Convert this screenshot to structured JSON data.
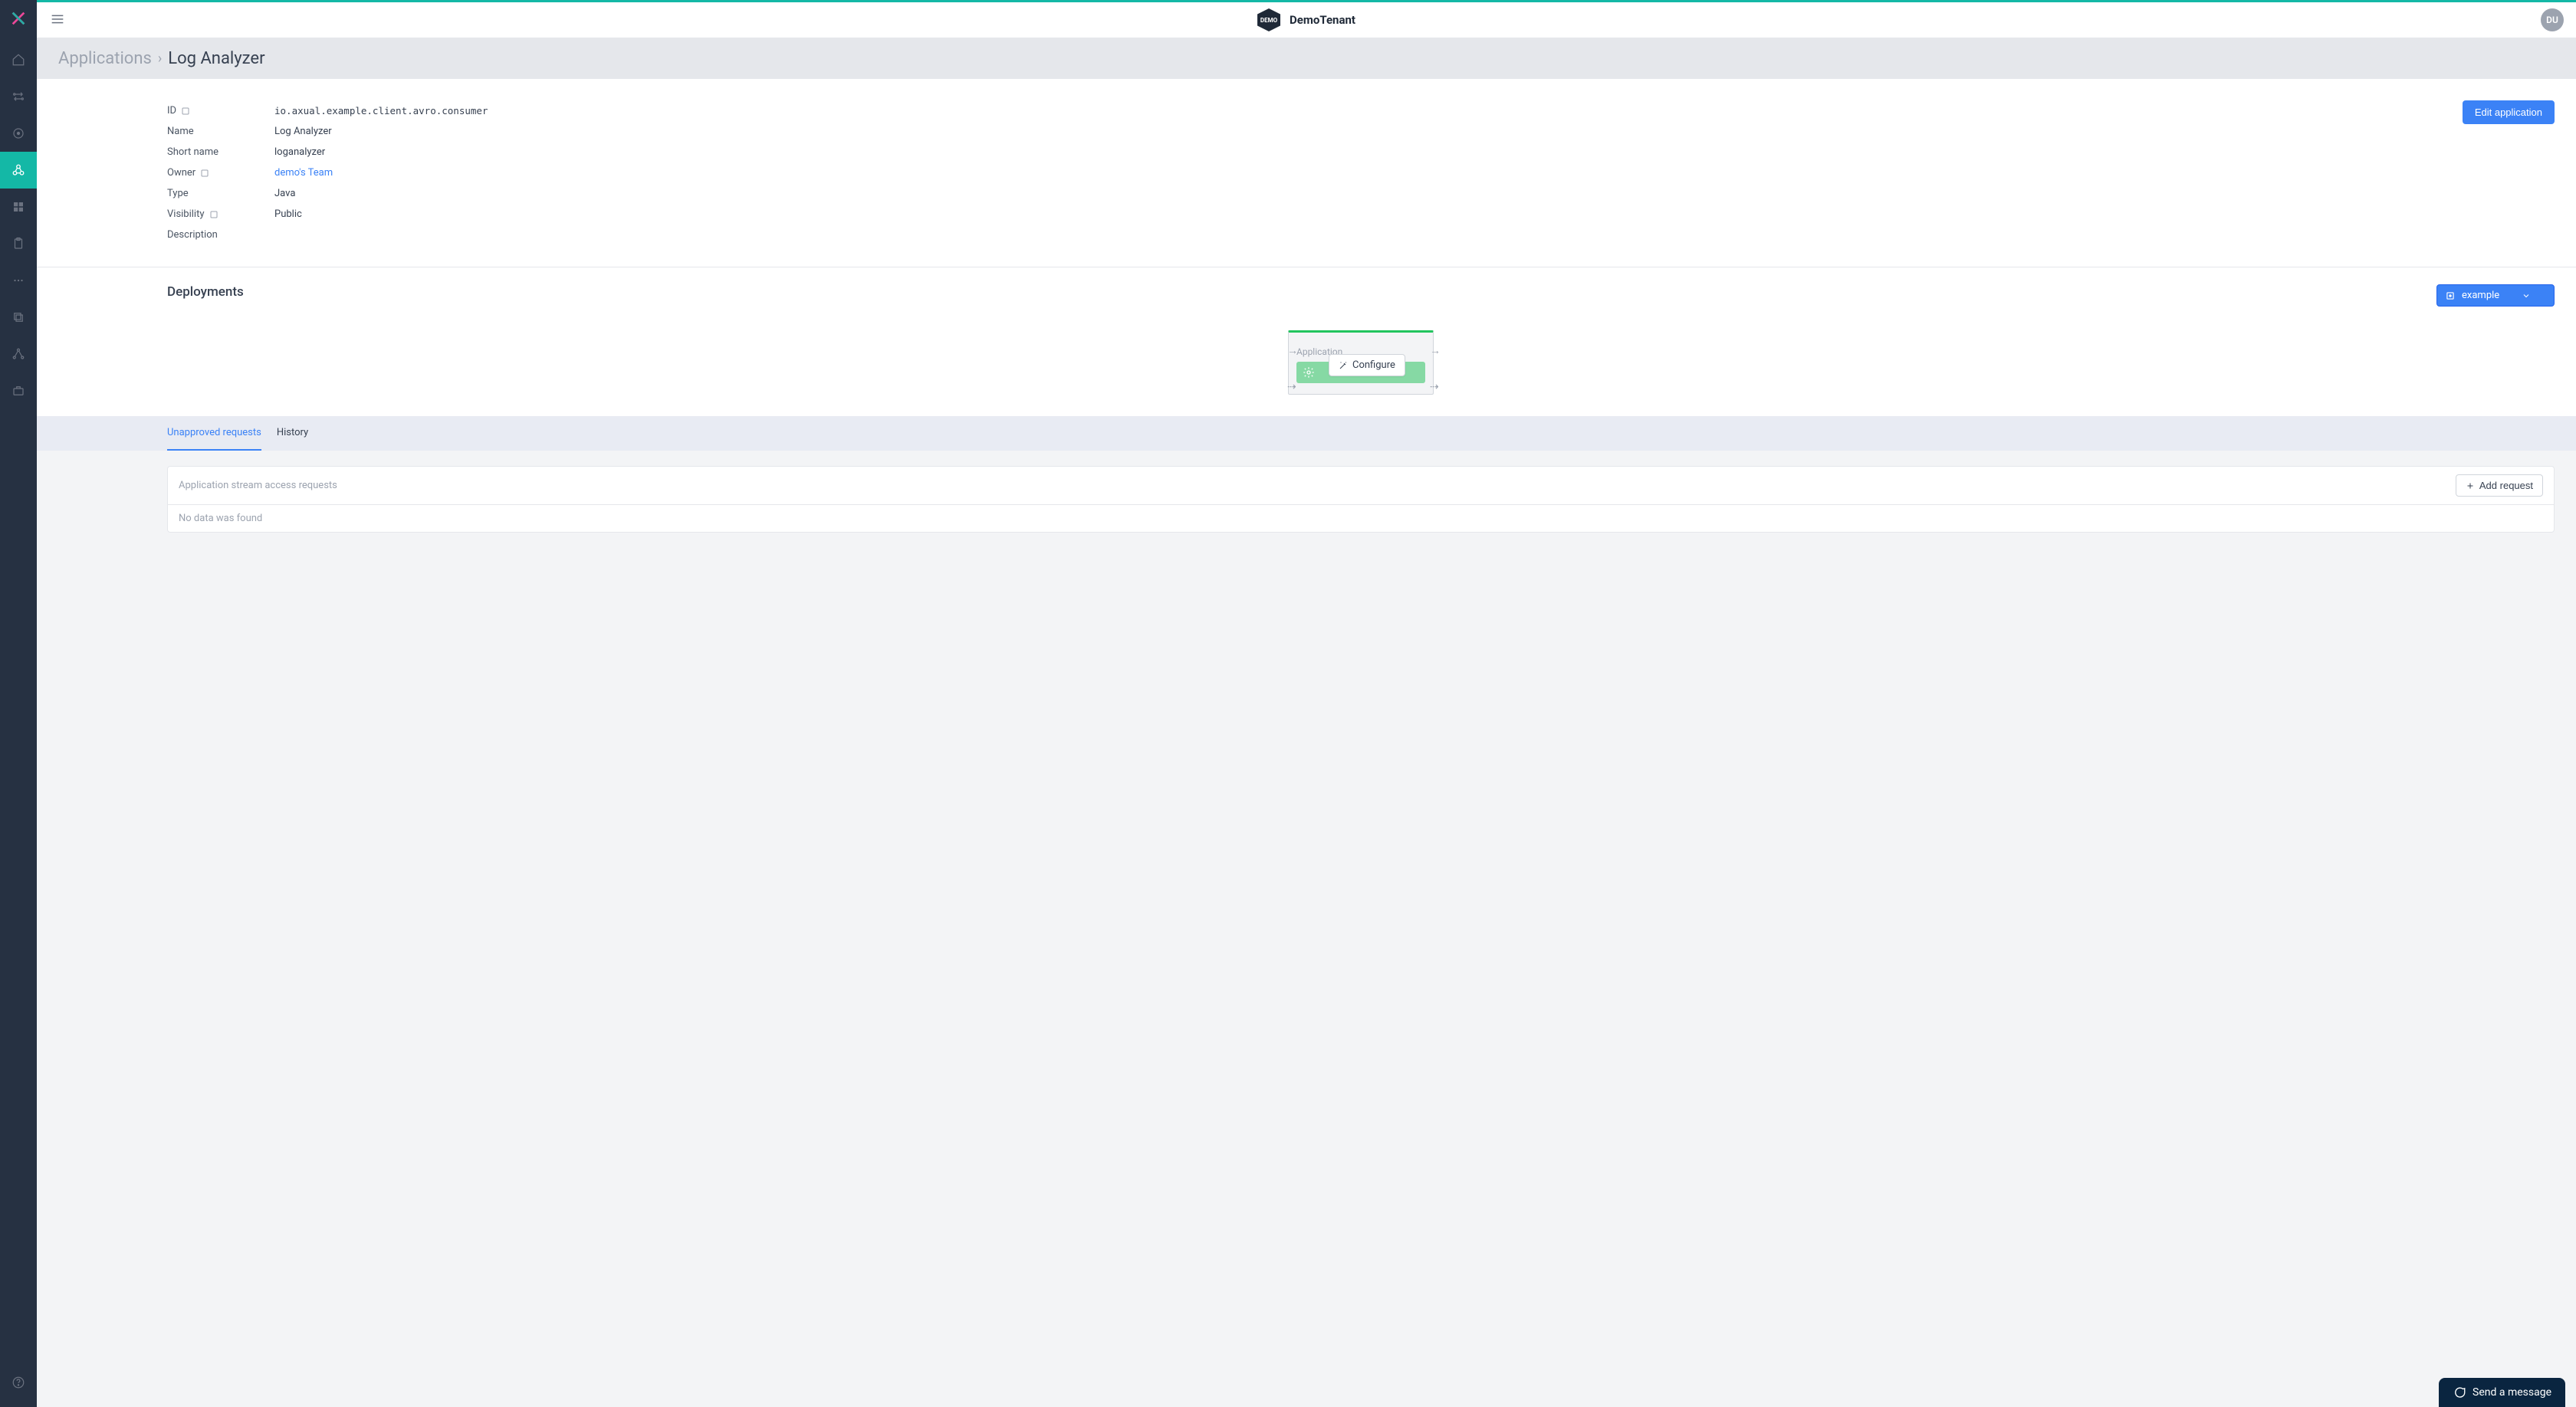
{
  "tenant": {
    "badge": "DEMO",
    "name": "DemoTenant"
  },
  "avatar": "DU",
  "breadcrumb": {
    "parent": "Applications",
    "current": "Log Analyzer"
  },
  "editButton": "Edit application",
  "details": {
    "idLabel": "ID",
    "idValue": "io.axual.example.client.avro.consumer",
    "nameLabel": "Name",
    "nameValue": "Log Analyzer",
    "shortNameLabel": "Short name",
    "shortNameValue": "loganalyzer",
    "ownerLabel": "Owner",
    "ownerValue": "demo's Team",
    "typeLabel": "Type",
    "typeValue": "Java",
    "visibilityLabel": "Visibility",
    "visibilityValue": "Public",
    "descriptionLabel": "Description",
    "descriptionValue": ""
  },
  "deployments": {
    "title": "Deployments",
    "environment": "example",
    "cardLabel": "Application",
    "configure": "Configure"
  },
  "tabs": {
    "unapproved": "Unapproved requests",
    "history": "History"
  },
  "requests": {
    "title": "Application stream access requests",
    "addButton": "Add request",
    "empty": "No data was found"
  },
  "chat": "Send a message"
}
